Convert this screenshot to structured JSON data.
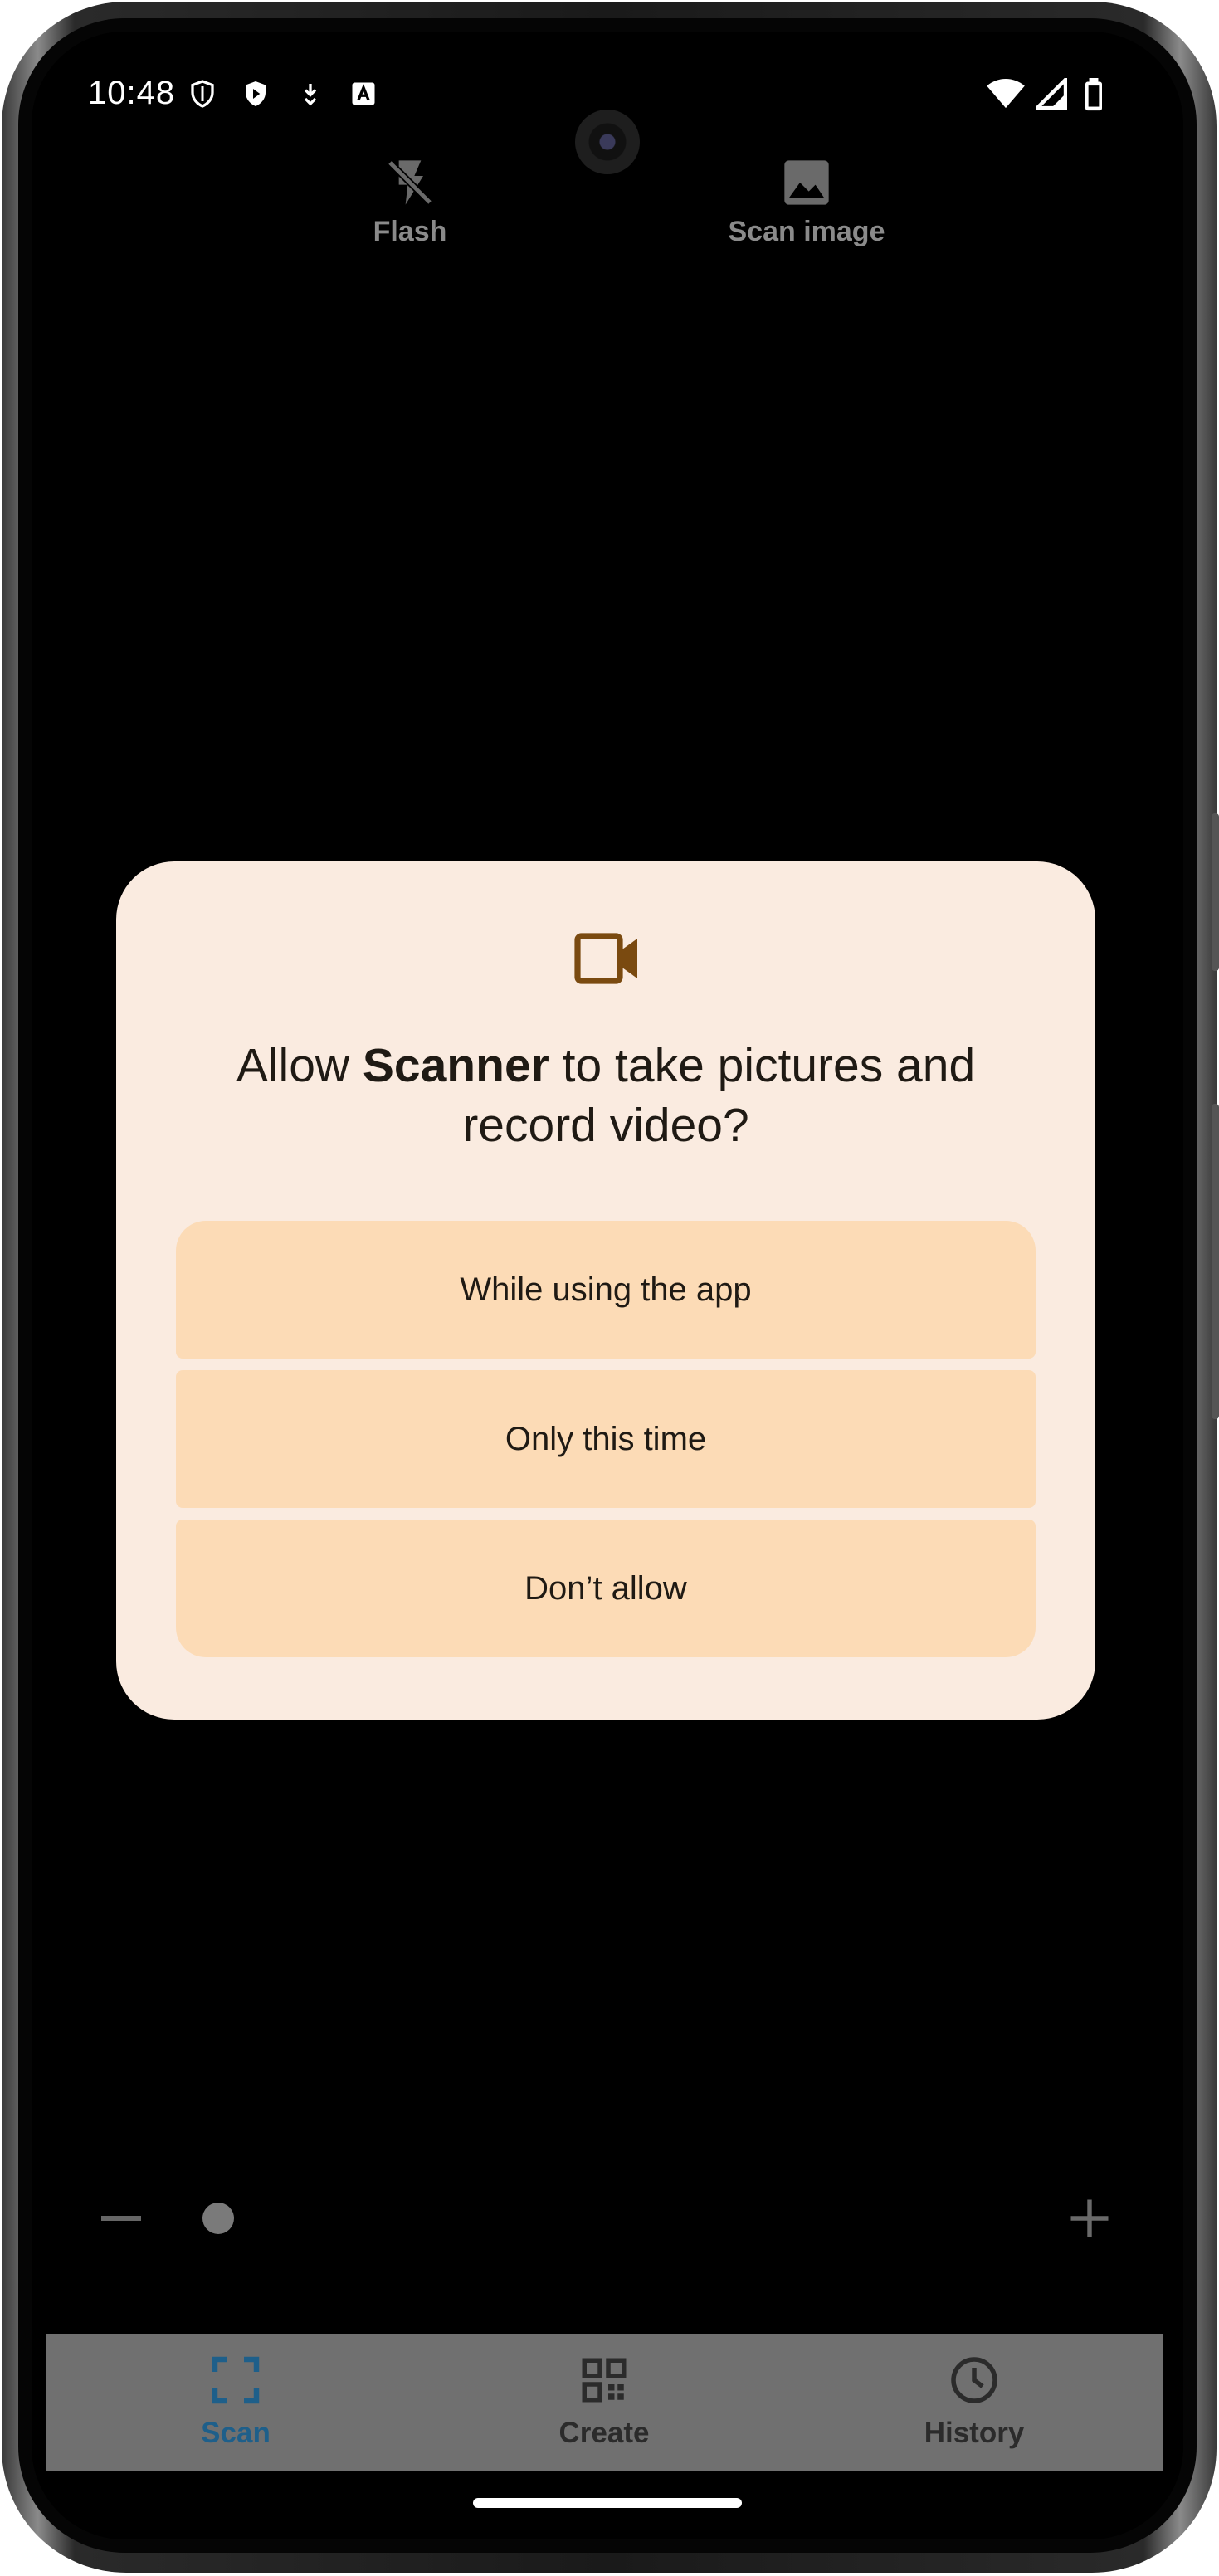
{
  "status_bar": {
    "time": "10:48",
    "left_icons": [
      "shield-outline-icon",
      "play-shield-icon",
      "download-icon",
      "a-box-icon"
    ],
    "right_icons": [
      "wifi-icon",
      "cell-signal-icon",
      "battery-icon"
    ]
  },
  "toolbar": {
    "flash_label": "Flash",
    "flash_icon": "flash-off-icon",
    "scan_image_label": "Scan image",
    "scan_image_icon": "image-icon"
  },
  "dialog": {
    "icon": "videocam-icon",
    "title_prefix": "Allow ",
    "title_app": "Scanner",
    "title_suffix": " to take pictures and record video?",
    "buttons": [
      {
        "label": "While using the app"
      },
      {
        "label": "Only this time"
      },
      {
        "label": "Don’t allow"
      }
    ],
    "colors": {
      "background": "#faebe0",
      "button": "#fcdbb6",
      "accent": "#7a4a10"
    }
  },
  "zoom": {
    "minus_icon": "minus-icon",
    "plus_icon": "plus-icon",
    "level": 0.0
  },
  "bottom_nav": {
    "items": [
      {
        "label": "Scan",
        "icon": "scan-frame-icon",
        "active": true
      },
      {
        "label": "Create",
        "icon": "qr-code-icon",
        "active": false
      },
      {
        "label": "History",
        "icon": "clock-icon",
        "active": false
      }
    ],
    "active_color": "#1e5f8a"
  }
}
